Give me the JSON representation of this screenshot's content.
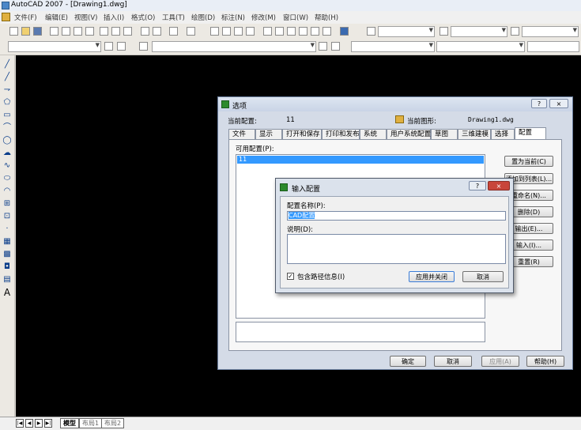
{
  "app": {
    "title": "AutoCAD 2007 - [Drawing1.dwg]"
  },
  "menu": [
    "文件(F)",
    "编辑(E)",
    "视图(V)",
    "插入(I)",
    "格式(O)",
    "工具(T)",
    "绘图(D)",
    "标注(N)",
    "修改(M)",
    "窗口(W)",
    "帮助(H)"
  ],
  "bottom_tabs": [
    "模型",
    "布局1",
    "布局2"
  ],
  "options_dialog": {
    "title": "选项",
    "current_profile_label": "当前配置:",
    "current_profile_value": "11",
    "current_drawing_label": "当前图形:",
    "current_drawing_value": "Drawing1.dwg",
    "tabs": [
      "文件",
      "显示",
      "打开和保存",
      "打印和发布",
      "系统",
      "用户系统配置",
      "草图",
      "三维建模",
      "选择",
      "配置"
    ],
    "available_profiles_label": "可用配置(P):",
    "profiles": [
      "11"
    ],
    "side_buttons": [
      "置为当前(C)",
      "添加到列表(L)...",
      "重命名(N)...",
      "删除(D)",
      "输出(E)...",
      "输入(I)...",
      "重置(R)"
    ],
    "footer_buttons": {
      "ok": "确定",
      "cancel": "取消",
      "apply": "应用(A)",
      "help": "帮助(H)"
    },
    "help_icon": "?",
    "close_icon": "×"
  },
  "import_dialog": {
    "title": "输入配置",
    "name_label": "配置名称(P):",
    "name_value": "CAD配置",
    "desc_label": "说明(D):",
    "desc_value": "",
    "checkbox_label": "包含路径信息(I)",
    "checkbox_checked": true,
    "apply_close": "应用并关闭",
    "cancel": "取消",
    "help_icon": "?",
    "close_icon": "×"
  },
  "colors": {
    "canvas": "#000000",
    "selection": "#3399ff",
    "close_red": "#c8453a"
  }
}
